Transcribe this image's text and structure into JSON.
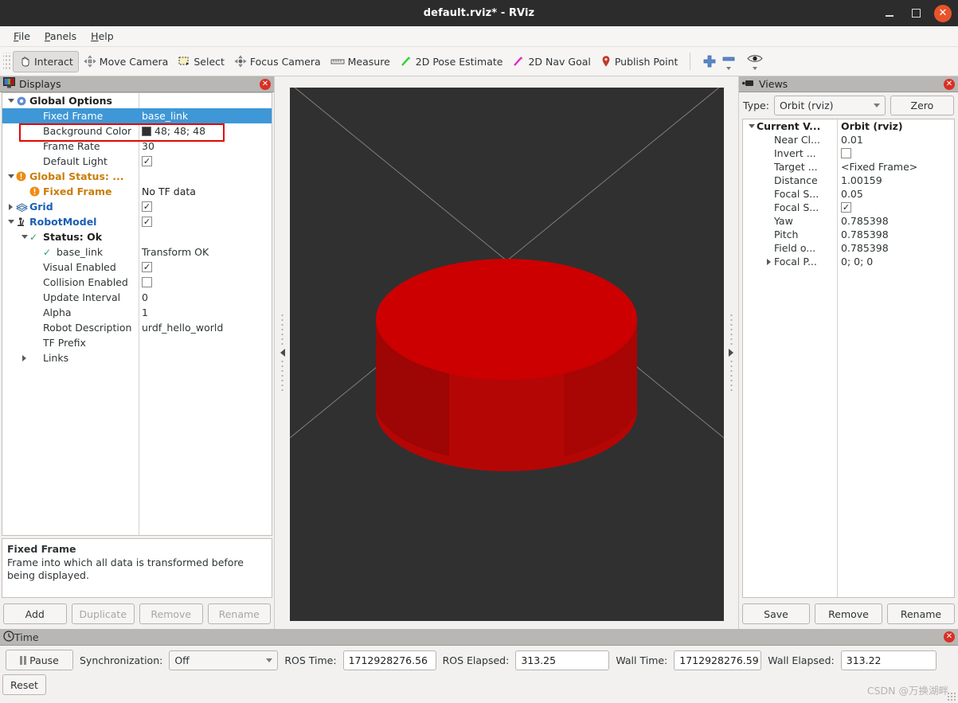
{
  "window": {
    "title": "default.rviz* - RViz",
    "minimize": "–",
    "maximize": "☐",
    "close": "✕"
  },
  "menubar": {
    "items": [
      "File",
      "Panels",
      "Help"
    ]
  },
  "toolbar": {
    "items": [
      {
        "label": "Interact",
        "icon": "hand-cursor-icon",
        "checked": true
      },
      {
        "label": "Move Camera",
        "icon": "move-camera-icon",
        "checked": false
      },
      {
        "label": "Select",
        "icon": "select-rectangle-icon",
        "checked": false
      },
      {
        "label": "Focus Camera",
        "icon": "focus-camera-icon",
        "checked": false
      },
      {
        "label": "Measure",
        "icon": "ruler-icon",
        "checked": false
      },
      {
        "label": "2D Pose Estimate",
        "icon": "green-arrow-icon",
        "checked": false
      },
      {
        "label": "2D Nav Goal",
        "icon": "magenta-arrow-icon",
        "checked": false
      },
      {
        "label": "Publish Point",
        "icon": "map-pin-icon",
        "checked": false
      }
    ],
    "extras": [
      {
        "icon": "plus-icon",
        "label": ""
      },
      {
        "icon": "minus-icon",
        "label": ""
      },
      {
        "icon": "eye-icon",
        "label": ""
      }
    ]
  },
  "displays": {
    "title": "Displays",
    "title_icon": "display-monitor-icon",
    "close_icon": "panel-close-icon",
    "rows": [
      {
        "indent": 0,
        "expander": "down",
        "icon": "gear-icon",
        "label": "Global Options",
        "style": "bold-dark",
        "value": "",
        "value_type": "text",
        "selected": false
      },
      {
        "indent": 1,
        "expander": "none",
        "icon": "none",
        "label": "Fixed Frame",
        "style": "plain",
        "value": "base_link",
        "value_type": "text",
        "selected": true
      },
      {
        "indent": 1,
        "expander": "none",
        "icon": "none",
        "label": "Background Color",
        "style": "plain",
        "value": "48; 48; 48",
        "value_type": "color",
        "selected": false,
        "color": "#303030"
      },
      {
        "indent": 1,
        "expander": "none",
        "icon": "none",
        "label": "Frame Rate",
        "style": "plain",
        "value": "30",
        "value_type": "text",
        "selected": false
      },
      {
        "indent": 1,
        "expander": "none",
        "icon": "none",
        "label": "Default Light",
        "style": "plain",
        "value": "",
        "value_type": "checked",
        "selected": false
      },
      {
        "indent": 0,
        "expander": "down",
        "icon": "warning-icon",
        "label": "Global Status: ...",
        "style": "warn",
        "value": "",
        "value_type": "text",
        "selected": false
      },
      {
        "indent": 1,
        "expander": "none",
        "icon": "warning-icon",
        "label": "Fixed Frame",
        "style": "warn",
        "value": "No TF data",
        "value_type": "text",
        "selected": false
      },
      {
        "indent": 0,
        "expander": "right",
        "icon": "grid-icon",
        "label": "Grid",
        "style": "bold-blue",
        "value": "",
        "value_type": "checked",
        "selected": false
      },
      {
        "indent": 0,
        "expander": "down",
        "icon": "robot-icon",
        "label": "RobotModel",
        "style": "bold-blue",
        "value": "",
        "value_type": "checked",
        "selected": false
      },
      {
        "indent": 1,
        "expander": "down",
        "icon": "ok-check-icon",
        "label": "Status: Ok",
        "style": "bold-dark",
        "value": "",
        "value_type": "text",
        "selected": false
      },
      {
        "indent": 2,
        "expander": "none",
        "icon": "ok-check-icon",
        "label": "base_link",
        "style": "plain",
        "value": "Transform OK",
        "value_type": "text",
        "selected": false
      },
      {
        "indent": 1,
        "expander": "none",
        "icon": "none",
        "label": "Visual Enabled",
        "style": "plain",
        "value": "",
        "value_type": "checked",
        "selected": false
      },
      {
        "indent": 1,
        "expander": "none",
        "icon": "none",
        "label": "Collision Enabled",
        "style": "plain",
        "value": "",
        "value_type": "unchecked",
        "selected": false
      },
      {
        "indent": 1,
        "expander": "none",
        "icon": "none",
        "label": "Update Interval",
        "style": "plain",
        "value": "0",
        "value_type": "text",
        "selected": false
      },
      {
        "indent": 1,
        "expander": "none",
        "icon": "none",
        "label": "Alpha",
        "style": "plain",
        "value": "1",
        "value_type": "text",
        "selected": false
      },
      {
        "indent": 1,
        "expander": "none",
        "icon": "none",
        "label": "Robot Description",
        "style": "plain",
        "value": "urdf_hello_world",
        "value_type": "text",
        "selected": false
      },
      {
        "indent": 1,
        "expander": "none",
        "icon": "none",
        "label": "TF Prefix",
        "style": "plain",
        "value": "",
        "value_type": "text",
        "selected": false
      },
      {
        "indent": 1,
        "expander": "right",
        "icon": "none",
        "label": "Links",
        "style": "plain",
        "value": "",
        "value_type": "text",
        "selected": false
      }
    ],
    "description": {
      "heading": "Fixed Frame",
      "body": "Frame into which all data is transformed before being displayed."
    },
    "buttons": [
      {
        "label": "Add",
        "enabled": true
      },
      {
        "label": "Duplicate",
        "enabled": false
      },
      {
        "label": "Remove",
        "enabled": false
      },
      {
        "label": "Rename",
        "enabled": false
      }
    ]
  },
  "views": {
    "title": "Views",
    "title_icon": "camera-icon",
    "close_icon": "panel-close-icon",
    "type_label": "Type:",
    "type_value": "Orbit (rviz)",
    "zero_button": "Zero",
    "rows": [
      {
        "indent": 0,
        "expander": "down",
        "label": "Current V...",
        "style": "bold-dark",
        "value": "Orbit (rviz)",
        "value_type": "text",
        "value_style": "bold-dark"
      },
      {
        "indent": 1,
        "expander": "none",
        "label": "Near Cl...",
        "style": "plain",
        "value": "0.01",
        "value_type": "text",
        "value_style": "plain"
      },
      {
        "indent": 1,
        "expander": "none",
        "label": "Invert ...",
        "style": "plain",
        "value": "",
        "value_type": "unchecked",
        "value_style": "plain"
      },
      {
        "indent": 1,
        "expander": "none",
        "label": "Target ...",
        "style": "plain",
        "value": "<Fixed Frame>",
        "value_type": "text",
        "value_style": "plain"
      },
      {
        "indent": 1,
        "expander": "none",
        "label": "Distance",
        "style": "plain",
        "value": "1.00159",
        "value_type": "text",
        "value_style": "plain"
      },
      {
        "indent": 1,
        "expander": "none",
        "label": "Focal S...",
        "style": "plain",
        "value": "0.05",
        "value_type": "text",
        "value_style": "plain"
      },
      {
        "indent": 1,
        "expander": "none",
        "label": "Focal S...",
        "style": "plain",
        "value": "",
        "value_type": "checked",
        "value_style": "plain"
      },
      {
        "indent": 1,
        "expander": "none",
        "label": "Yaw",
        "style": "plain",
        "value": "0.785398",
        "value_type": "text",
        "value_style": "plain"
      },
      {
        "indent": 1,
        "expander": "none",
        "label": "Pitch",
        "style": "plain",
        "value": "0.785398",
        "value_type": "text",
        "value_style": "plain"
      },
      {
        "indent": 1,
        "expander": "none",
        "label": "Field o...",
        "style": "plain",
        "value": "0.785398",
        "value_type": "text",
        "value_style": "plain"
      },
      {
        "indent": 1,
        "expander": "right",
        "label": "Focal P...",
        "style": "plain",
        "value": "0; 0; 0",
        "value_type": "text",
        "value_style": "plain"
      }
    ],
    "buttons": [
      {
        "label": "Save",
        "enabled": true
      },
      {
        "label": "Remove",
        "enabled": true
      },
      {
        "label": "Rename",
        "enabled": true
      }
    ]
  },
  "viewport": {
    "background_color": "#303030",
    "grid_line_color": "#9a9a9a",
    "model_color": "#cc0000",
    "model_shape": "cylinder"
  },
  "time": {
    "title": "Time",
    "title_icon": "clock-icon",
    "close_icon": "panel-close-icon",
    "pause_label": "Pause",
    "sync_label": "Synchronization:",
    "sync_value": "Off",
    "ros_time_label": "ROS Time:",
    "ros_time_value": "1712928276.56",
    "ros_elapsed_label": "ROS Elapsed:",
    "ros_elapsed_value": "313.25",
    "wall_time_label": "Wall Time:",
    "wall_time_value": "1712928276.59",
    "wall_elapsed_label": "Wall Elapsed:",
    "wall_elapsed_value": "313.22",
    "reset_label": "Reset"
  },
  "watermark": "CSDN @万换湖畔"
}
